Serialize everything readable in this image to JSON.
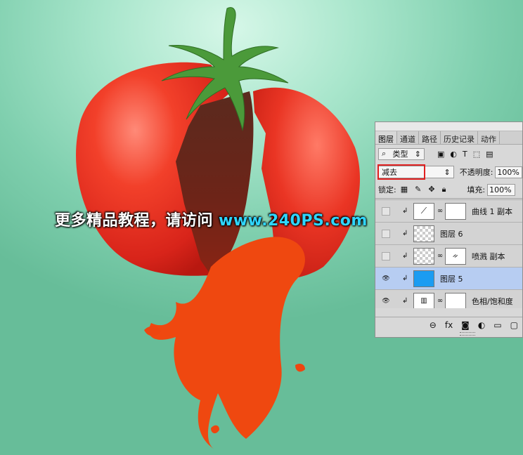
{
  "watermark": {
    "text_cn": "更多精品教程，请访问",
    "url": "www.240PS.com"
  },
  "layers_panel": {
    "tabs": [
      {
        "label": "图层"
      },
      {
        "label": "通道"
      },
      {
        "label": "路径"
      },
      {
        "label": "历史记录"
      },
      {
        "label": "动作"
      }
    ],
    "filter_kind": "类型",
    "filter_icons": [
      "image-icon",
      "adjustment-icon",
      "type-icon",
      "shape-icon",
      "smart-object-icon"
    ],
    "blend_mode": "减去",
    "opacity_label": "不透明度:",
    "opacity_value": "100%",
    "lock_label": "锁定:",
    "fill_label": "填充:",
    "fill_value": "100%",
    "layers": [
      {
        "name": "曲线 1 副本",
        "visible": false,
        "thumb": "curves-icon",
        "mask": "white"
      },
      {
        "name": "图层 6",
        "visible": false,
        "thumb": "checker"
      },
      {
        "name": "喷溅 副本",
        "visible": false,
        "thumb": "checker",
        "mask": "splash"
      },
      {
        "name": "图层 5",
        "visible": true,
        "selected": true,
        "thumb": "blue"
      },
      {
        "name": "色相/饱和度",
        "visible": true,
        "thumb": "hue-sat-icon",
        "mask": "white",
        "partial": true
      }
    ],
    "colors": {
      "selected_row": "#b7cdf2",
      "layer5_fill": "#1b9cf2",
      "highlight_box": "#e02020"
    }
  }
}
